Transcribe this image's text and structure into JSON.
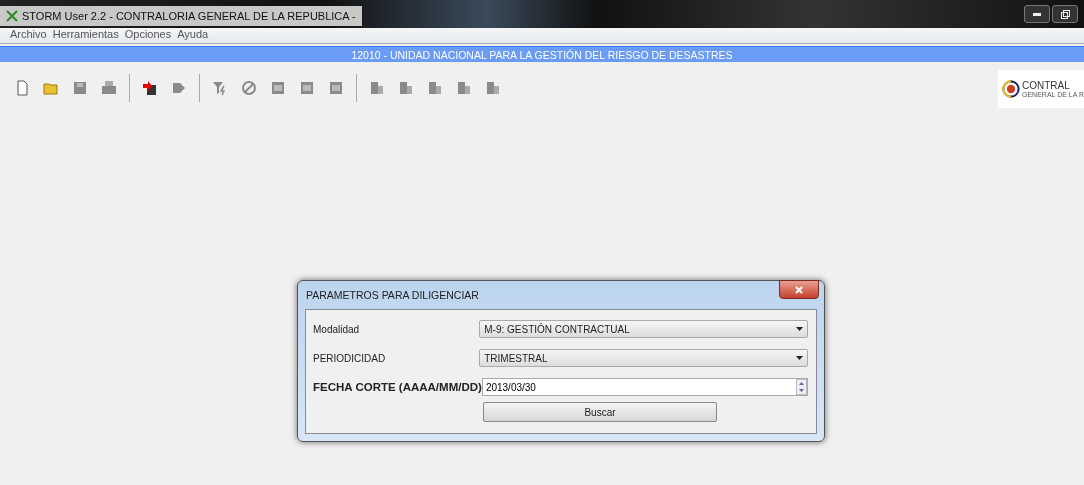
{
  "window": {
    "title": "STORM User 2.2 - CONTRALORIA GENERAL DE LA REPUBLICA -"
  },
  "menu": [
    "Archivo",
    "Herramientas",
    "Opciones",
    "Ayuda"
  ],
  "entity_bar": "12010 - UNIDAD NACIONAL PARA LA GESTIÓN DEL RIESGO DE DESASTRES",
  "logo": {
    "name": "CONTRAL",
    "subtitle": "GENERAL DE LA R"
  },
  "dialog": {
    "title": "PARAMETROS PARA DILIGENCIAR",
    "fields": [
      {
        "kind": "select",
        "label": "Modalidad",
        "value": "M-9: GESTIÓN CONTRACTUAL"
      },
      {
        "kind": "select",
        "label": "PERIODICIDAD",
        "value": "TRIMESTRAL"
      },
      {
        "kind": "spinner",
        "label": "FECHA CORTE (AAAA/MM/DD)",
        "value": "2013/03/30"
      }
    ],
    "button": "Buscar"
  }
}
